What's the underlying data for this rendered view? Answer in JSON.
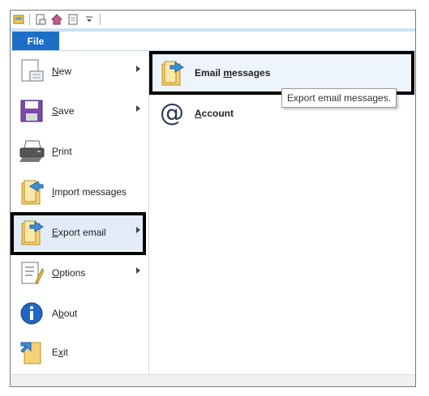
{
  "file_tab": {
    "label": "File"
  },
  "menu_items": [
    {
      "id": "new",
      "label": "New",
      "underline": "N",
      "has_submenu": true
    },
    {
      "id": "save",
      "label": "Save",
      "underline": "S",
      "has_submenu": true
    },
    {
      "id": "print",
      "label": "Print",
      "underline": "P",
      "has_submenu": false
    },
    {
      "id": "import",
      "label": "Import messages",
      "underline": "I",
      "has_submenu": false
    },
    {
      "id": "export",
      "label": "Export email",
      "underline": "E",
      "has_submenu": true,
      "selected": true
    },
    {
      "id": "options",
      "label": "Options",
      "underline": "O",
      "has_submenu": true
    },
    {
      "id": "about",
      "label": "About",
      "underline": "b",
      "has_submenu": false
    },
    {
      "id": "exit",
      "label": "Exit",
      "underline": "x",
      "has_submenu": false
    }
  ],
  "submenu": [
    {
      "id": "email-messages",
      "label": "Email messages",
      "underline": "m",
      "hovered": true
    },
    {
      "id": "account",
      "label": "Account",
      "underline": "A"
    }
  ],
  "tooltip": {
    "text": "Export email messages."
  },
  "colors": {
    "accent": "#1e6ec8",
    "highlight_border": "#000000",
    "selected_bg": "#e2ecf7"
  },
  "quick_access_icons": [
    "app-icon",
    "new-document-icon",
    "home-icon",
    "page-icon",
    "customize-arrow-icon"
  ]
}
